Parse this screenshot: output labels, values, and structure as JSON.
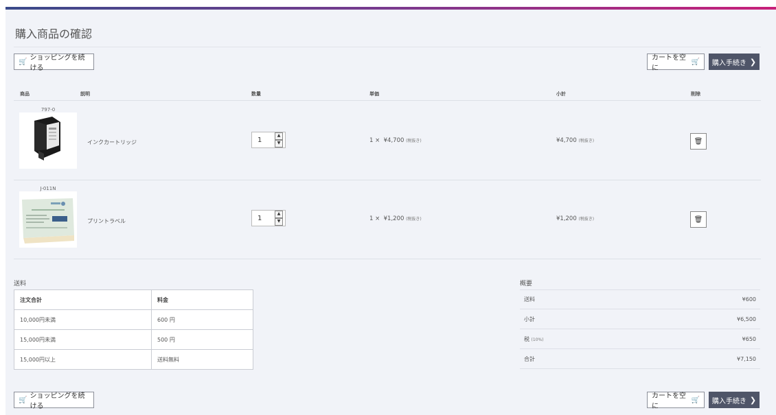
{
  "page_title": "購入商品の確認",
  "actions": {
    "continue_shopping": "ショッピングを続ける",
    "empty_cart": "カートを空に",
    "checkout": "購入手続き"
  },
  "table_headers": {
    "product": "商品",
    "description": "説明",
    "quantity": "数量",
    "unit_price": "単価",
    "subtotal": "小計",
    "delete": "削除"
  },
  "items": [
    {
      "sku": "797-0",
      "description": "インクカートリッジ",
      "qty": "1",
      "times": "1 ×",
      "unit_price": "¥4,700",
      "unit_note": "(税抜き)",
      "subtotal": "¥4,700",
      "subtotal_note": "(税抜き)"
    },
    {
      "sku": "J-011N",
      "description": "プリントラベル",
      "qty": "1",
      "times": "1 ×",
      "unit_price": "¥1,200",
      "unit_note": "(税抜き)",
      "subtotal": "¥1,200",
      "subtotal_note": "(税抜き)"
    }
  ],
  "shipping": {
    "label": "送料",
    "headers": [
      "注文合計",
      "料金"
    ],
    "rows": [
      [
        "10,000円未満",
        "600 円"
      ],
      [
        "15,000円未満",
        "500 円"
      ],
      [
        "15,000円以上",
        "送料無料"
      ]
    ]
  },
  "summary": {
    "label": "概要",
    "rows": [
      {
        "label": "送料",
        "note": "",
        "value": "¥600"
      },
      {
        "label": "小計",
        "note": "",
        "value": "¥6,500"
      },
      {
        "label": "税",
        "note": "(10%)",
        "value": "¥650"
      },
      {
        "label": "合計",
        "note": "",
        "value": "¥7,150"
      }
    ]
  },
  "icons": {
    "cart": "cart-icon",
    "trash": "trash-icon",
    "chevron": "chevron-right-icon"
  },
  "colors": {
    "accent_dark": "#4f5568",
    "page_bg": "#f1f3f8"
  }
}
